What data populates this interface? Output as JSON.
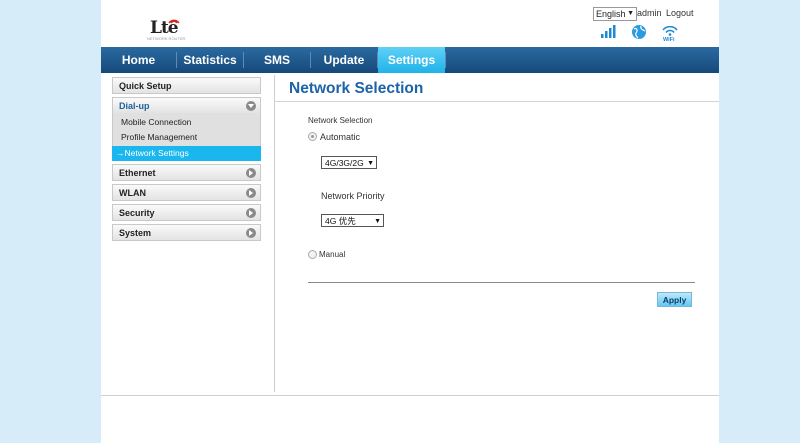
{
  "header": {
    "logo_text": "Lte",
    "logo_sub": "NETWORK ROUTER",
    "language": "English",
    "user": "admin",
    "logout": "Logout",
    "icons": [
      "signal-bars-icon",
      "globe-icon",
      "wifi-icon"
    ]
  },
  "nav": {
    "items": [
      {
        "label": "Home"
      },
      {
        "label": "Statistics"
      },
      {
        "label": "SMS"
      },
      {
        "label": "Update"
      },
      {
        "label": "Settings",
        "active": true
      }
    ]
  },
  "sidebar": {
    "quick_setup": "Quick Setup",
    "dialup": "Dial-up",
    "dialup_sub": [
      "Mobile Connection",
      "Profile Management",
      "→Network Settings"
    ],
    "ethernet": "Ethernet",
    "wlan": "WLAN",
    "security": "Security",
    "system": "System"
  },
  "content": {
    "title": "Network Selection",
    "section_label": "Network Selection",
    "automatic": "Automatic",
    "mode_value": "4G/3G/2G",
    "priority_label": "Network Priority",
    "priority_value": "4G 优先",
    "manual": "Manual",
    "apply": "Apply"
  },
  "colors": {
    "nav_bg": "#1c5589",
    "nav_active": "#1fb3ea",
    "title": "#1d63a8",
    "page_bg": "#d6ecf8"
  }
}
